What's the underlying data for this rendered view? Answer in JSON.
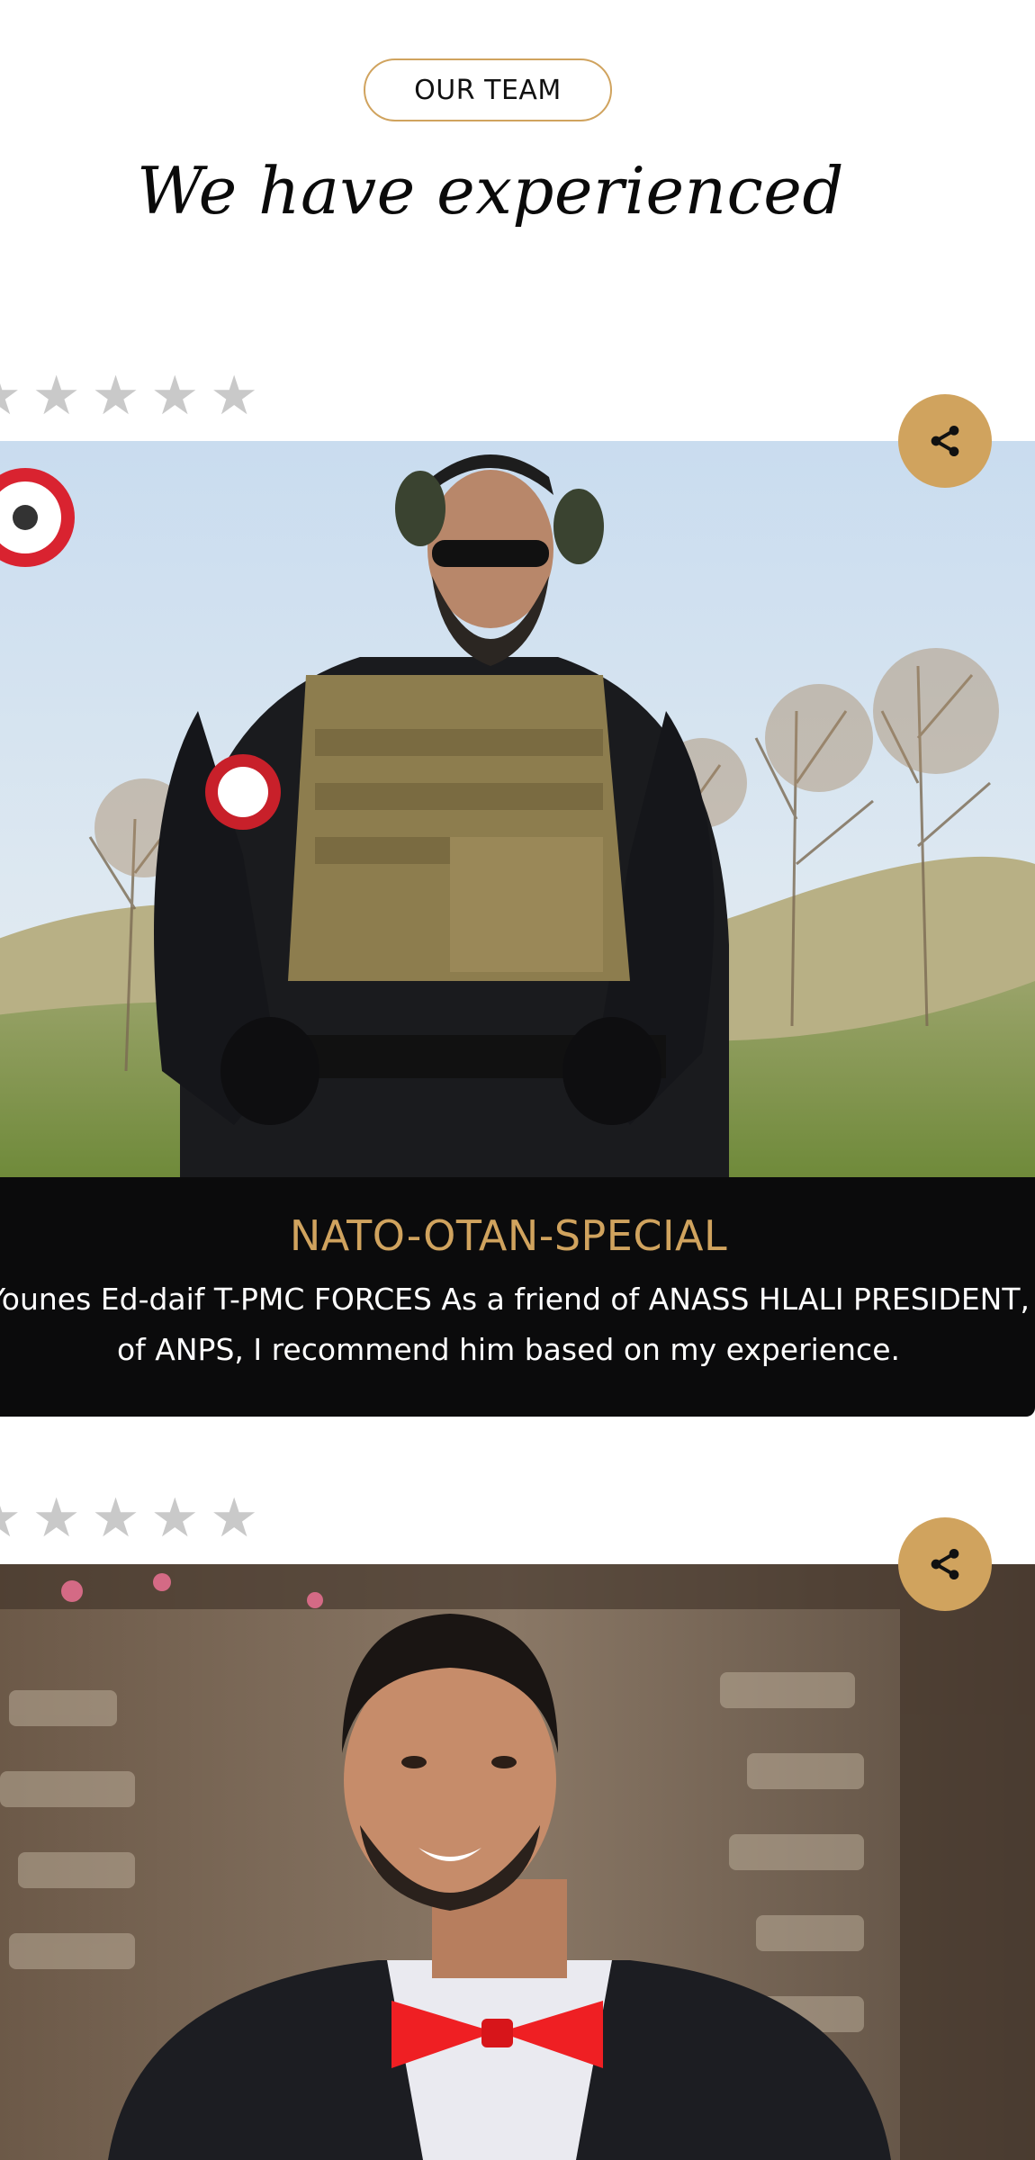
{
  "section": {
    "eyebrow": "OUR TEAM",
    "title": "We have experienced"
  },
  "icons": {
    "star": "star-icon",
    "share": "share-icon"
  },
  "colors": {
    "accent": "#d0a35e",
    "caption_bg": "#0b0b0c",
    "star": "#c9c9c9"
  },
  "members": [
    {
      "name": "NATO-OTAN-SPECIAL",
      "quote": "Younes Ed-daif T-PMC FORCES As a friend of ANASS HLALI PRESIDENT,\nof ANPS, I recommend him based on my experience.",
      "rating_shown": 5
    },
    {
      "rating_shown": 5
    }
  ],
  "stars": [
    "★",
    "★",
    "★",
    "★",
    "★"
  ]
}
